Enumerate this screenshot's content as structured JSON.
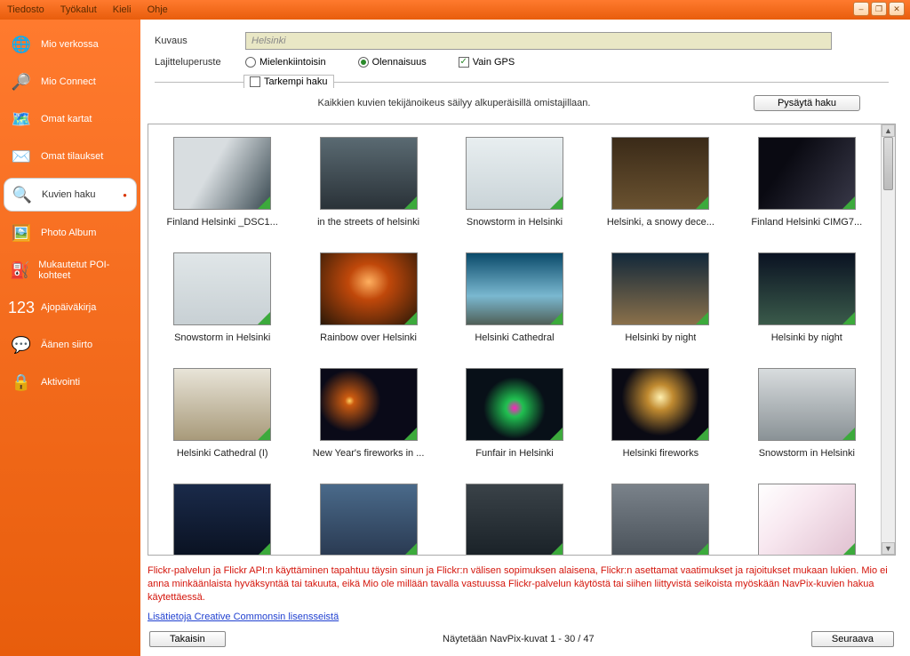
{
  "menubar": {
    "items": [
      "Tiedosto",
      "Työkalut",
      "Kieli",
      "Ohje"
    ]
  },
  "window_controls": {
    "min": "–",
    "max": "❐",
    "close": "✕"
  },
  "sidebar": {
    "items": [
      {
        "label": "Mio verkossa",
        "icon": "🌐"
      },
      {
        "label": "Mio Connect",
        "icon": "🔎"
      },
      {
        "label": "Omat kartat",
        "icon": "🗺️"
      },
      {
        "label": "Omat tilaukset",
        "icon": "✉️"
      },
      {
        "label": "Kuvien haku",
        "icon": "🔍",
        "active": true
      },
      {
        "label": "Photo Album",
        "icon": "🖼️"
      },
      {
        "label": "Mukautetut POI-kohteet",
        "icon": "⛽"
      },
      {
        "label": "Ajopäiväkirja",
        "icon": "123"
      },
      {
        "label": "Äänen siirto",
        "icon": "💬"
      },
      {
        "label": "Aktivointi",
        "icon": "🔒"
      }
    ]
  },
  "search": {
    "desc_label": "Kuvaus",
    "desc_value": "Helsinki",
    "sort_label": "Lajitteluperuste",
    "sort_options": [
      {
        "label": "Mielenkiintoisin",
        "selected": false,
        "type": "radio"
      },
      {
        "label": "Olennaisuus",
        "selected": true,
        "type": "radio"
      },
      {
        "label": "Vain GPS",
        "selected": true,
        "type": "check"
      }
    ],
    "advanced_label": "Tarkempi haku",
    "copyright_note": "Kaikkien kuvien tekijänoikeus säilyy alkuperäisillä omistajillaan.",
    "stop_button": "Pysäytä haku"
  },
  "gallery": {
    "items": [
      {
        "label": "Finland Helsinki _DSC1...",
        "bg": "bg1"
      },
      {
        "label": "in the streets of helsinki",
        "bg": "bg2"
      },
      {
        "label": "Snowstorm in Helsinki",
        "bg": "bg3"
      },
      {
        "label": "Helsinki, a snowy dece...",
        "bg": "bg4"
      },
      {
        "label": "Finland Helsinki CIMG7...",
        "bg": "bg5"
      },
      {
        "label": "Snowstorm in Helsinki",
        "bg": "bg6"
      },
      {
        "label": "Rainbow over Helsinki",
        "bg": "bg7"
      },
      {
        "label": "Helsinki Cathedral",
        "bg": "bg8"
      },
      {
        "label": "Helsinki by night",
        "bg": "bg9"
      },
      {
        "label": "Helsinki by night",
        "bg": "bg10"
      },
      {
        "label": "Helsinki Cathedral (I)",
        "bg": "bg11"
      },
      {
        "label": "New Year's fireworks in ...",
        "bg": "bg12"
      },
      {
        "label": "Funfair in Helsinki",
        "bg": "bg13"
      },
      {
        "label": "Helsinki fireworks",
        "bg": "bg14"
      },
      {
        "label": "Snowstorm in Helsinki",
        "bg": "bg15"
      },
      {
        "label": "",
        "bg": "bg16"
      },
      {
        "label": "",
        "bg": "bg17"
      },
      {
        "label": "",
        "bg": "bg18"
      },
      {
        "label": "",
        "bg": "bg19"
      },
      {
        "label": "",
        "bg": "bg20"
      }
    ]
  },
  "disclaimer": "Flickr-palvelun ja Flickr API:n käyttäminen tapahtuu täysin sinun ja Flickr:n välisen sopimuksen alaisena, Flickr:n asettamat vaatimukset ja rajoitukset mukaan lukien. Mio ei anna minkäänlaista hyväksyntää tai takuuta, eikä Mio ole millään tavalla vastuussa Flickr-palvelun käytöstä tai siihen liittyvistä seikoista myöskään NavPix-kuvien hakua käytettäessä.",
  "cc_link": "Lisätietoja Creative Commonsin lisensseistä",
  "footer": {
    "back": "Takaisin",
    "status": "Näytetään NavPix-kuvat 1 - 30 / 47",
    "next": "Seuraava"
  }
}
